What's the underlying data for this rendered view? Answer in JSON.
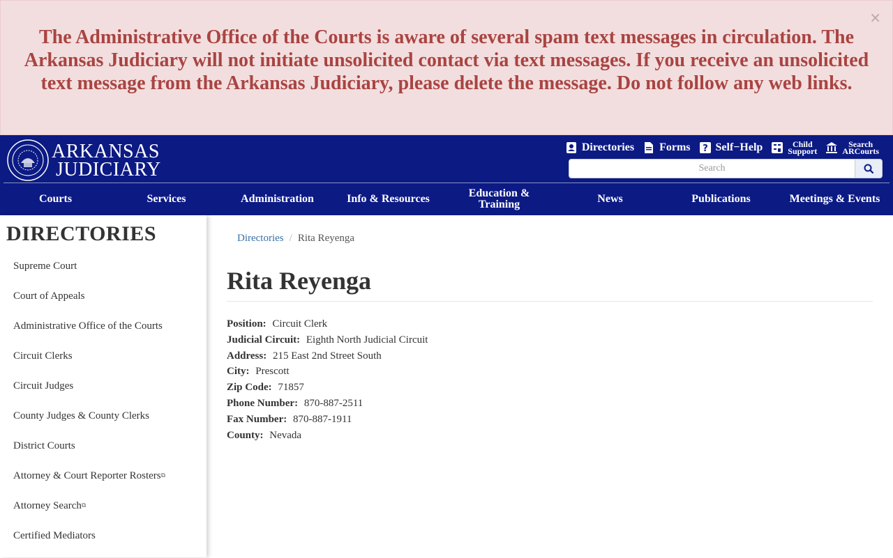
{
  "alert": {
    "message": "The Administrative Office of the Courts is aware of several spam text messages in circulation. The Arkansas Judiciary will not initiate unsolicited contact via text messages. If you receive an unsolicited text message from the Arkansas Judiciary, please delete the message. Do not follow any web links.",
    "close_label": "×"
  },
  "header": {
    "logo_line1": "ARKANSAS",
    "logo_line2": "JUDICIARY",
    "utility_links": {
      "directories": "Directories",
      "forms": "Forms",
      "self_help": "Self−Help",
      "child_support_1": "Child",
      "child_support_2": "Support",
      "search_arcourts_1": "Search",
      "search_arcourts_2": "ARCourts"
    },
    "search_placeholder": "Search"
  },
  "nav": {
    "items": [
      "Courts",
      "Services",
      "Administration",
      "Info & Resources",
      "Education & Training",
      "News",
      "Publications",
      "Meetings & Events"
    ]
  },
  "sidebar": {
    "title": "DIRECTORIES",
    "items": [
      "Supreme Court",
      "Court of Appeals",
      "Administrative Office of the Courts",
      "Circuit Clerks",
      "Circuit Judges",
      "County Judges & County Clerks",
      "District Courts",
      "Attorney & Court Reporter Rosters",
      "Attorney Search",
      "Certified Mediators"
    ],
    "external_marker": "⧉"
  },
  "main": {
    "breadcrumb": {
      "parent": "Directories",
      "current": "Rita Reyenga"
    },
    "title": "Rita Reyenga",
    "fields": [
      {
        "label": "Position:",
        "value": "Circuit Clerk"
      },
      {
        "label": "Judicial Circuit:",
        "value": "Eighth North Judicial Circuit"
      },
      {
        "label": "Address:",
        "value": "215 East 2nd Street South"
      },
      {
        "label": "City:",
        "value": "Prescott"
      },
      {
        "label": "Zip Code:",
        "value": "71857"
      },
      {
        "label": "Phone Number:",
        "value": "870-887-2511"
      },
      {
        "label": "Fax Number:",
        "value": "870-887-1911"
      },
      {
        "label": "County:",
        "value": "Nevada"
      }
    ]
  },
  "colors": {
    "header_bg": "#0c1a84",
    "alert_bg": "#f2dede",
    "alert_text": "#a94442",
    "link": "#3a6fa7"
  }
}
